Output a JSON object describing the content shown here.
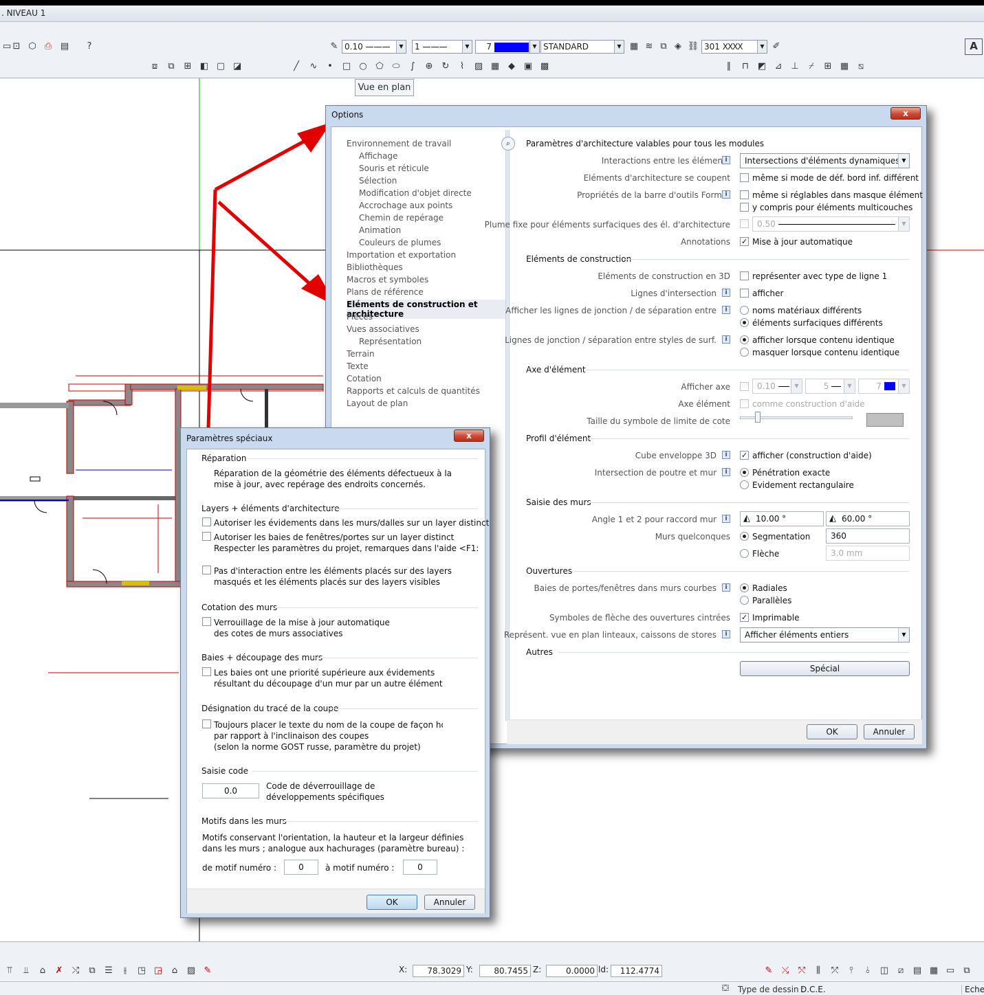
{
  "app": {
    "window_title": ". NIVEAU 1"
  },
  "toolbar": {
    "pen_value": "0.10",
    "line_value": "1",
    "color_value": "7",
    "layer_value": "STANDARD",
    "hatch_value": "301",
    "tooltip": "Vue en plan",
    "color_accent": "#0000ff"
  },
  "options": {
    "title": "Options",
    "close_label": "x",
    "nav": [
      "Environnement de travail",
      "Affichage",
      "Souris et réticule",
      "Sélection",
      "Modification d'objet directe",
      "Accrochage aux points",
      "Chemin de repérage",
      "Animation",
      "Couleurs de plumes",
      "Importation et exportation",
      "Bibliothèques",
      "Macros et symboles",
      "Plans de référence",
      "Eléments de construction et architecture",
      "Pièces",
      "Vues associatives",
      "Représentation",
      "Terrain",
      "Texte",
      "Cotation",
      "Rapports et calculs de quantités",
      "Layout de plan"
    ],
    "main_header": "Paramètres d'architecture valables pour tous les modules",
    "labels": {
      "interactions": "Interactions entre les éléments",
      "se_coupent": "Eléments d'architecture se coupent",
      "proprietes": "Propriétés de la barre d'outils Format",
      "plume_fixe": "Plume fixe pour éléments surfaciques des él. d'architecture",
      "annotations": "Annotations",
      "elements_3d": "Eléments de construction en 3D",
      "lignes_inter": "Lignes d'intersection",
      "afficher_lignes": "Afficher les lignes de jonction / de séparation entre",
      "lignes_styles": "Lignes de jonction / séparation entre styles de surf.",
      "afficher_axe": "Afficher axe",
      "axe_element": "Axe élément",
      "taille_symbole": "Taille du symbole de limite de cote",
      "cube": "Cube enveloppe 3D",
      "intersection_poutre": "Intersection de poutre et mur",
      "angle": "Angle 1 et 2 pour raccord mur",
      "murs_quelconques": "Murs quelconques",
      "baies_courbes": "Baies de portes/fenêtres dans murs courbes",
      "symboles_fleche": "Symboles de flèche des ouvertures cintrées",
      "represent": "Représent. vue en plan linteaux, caissons de stores"
    },
    "sections": {
      "construction": "Eléments de construction",
      "axe": "Axe d'élément",
      "profil": "Profil d'élément",
      "saisie": "Saisie des murs",
      "ouvertures": "Ouvertures",
      "autres": "Autres"
    },
    "values": {
      "interactions_combo": "Intersections d'éléments dynamiques",
      "chk_bord": "même si mode de déf. bord inf. différent",
      "chk_masque": "même si réglables dans masque élément",
      "chk_multicouches": "y compris pour éléments multicouches",
      "plume_val": "0.50",
      "chk_maj": "Mise à jour automatique",
      "chk_type_ligne": "représenter avec type de ligne 1",
      "chk_afficher": "afficher",
      "rad_noms": "noms matériaux différents",
      "rad_surf": "éléments surfaciques différents",
      "rad_afficher_id": "afficher lorsque contenu identique",
      "rad_masquer_id": "masquer lorsque contenu identique",
      "axe_pen": "0.10",
      "axe_line": "5",
      "axe_color": "7",
      "chk_aide": "comme construction d'aide",
      "chk_cube": "afficher (construction d'aide)",
      "rad_penetration": "Pénétration exacte",
      "rad_evidement": "Evidement rectangulaire",
      "angle1": "10.00 °",
      "angle2": "60.00 °",
      "rad_segmentation": "Segmentation",
      "segmentation_val": "360",
      "rad_fleche": "Flèche",
      "fleche_val": "3.0 mm",
      "rad_radiales": "Radiales",
      "rad_paralleles": "Parallèles",
      "chk_imprimable": "Imprimable",
      "represent_combo": "Afficher éléments entiers",
      "special_btn": "Spécial",
      "color_swatch": "#c0c0c0"
    },
    "ok": "OK",
    "cancel": "Annuler"
  },
  "special": {
    "title": "Paramètres spéciaux",
    "close_label": "x",
    "groups": {
      "reparation": "Réparation",
      "layers": "Layers + éléments d'architecture",
      "cotation": "Cotation des murs",
      "baies": "Baies + découpage des murs",
      "designation": "Désignation du tracé de la coupe",
      "saisie_code": "Saisie code",
      "motifs": "Motifs dans les murs"
    },
    "texts": {
      "rep_1": "Réparation de la géométrie des éléments défectueux à la",
      "rep_2": "mise à jour, avec repérage des endroits concernés.",
      "lay_1": "Autoriser les évidements dans les murs/dalles sur un layer distinct",
      "lay_2": "Autoriser les baies de fenêtres/portes sur un layer distinct",
      "lay_2b": "Respecter les paramètres du projet, remarques dans l'aide <F1:",
      "lay_3": "Pas d'interaction entre les éléments placés sur des layers",
      "lay_3b": "masqués et les éléments placés sur des layers visibles",
      "cot_1": "Verrouillage de la mise à jour automatique",
      "cot_1b": "des cotes de murs associatives",
      "baie_1": "Les baies ont une priorité supérieure aux évidements",
      "baie_1b": "résultant du découpage d'un mur par un autre élément",
      "des_1": "Toujours placer le texte du nom de la coupe de façon horizonta",
      "des_1b": "par rapport à l'inclinaison des coupes",
      "des_1c": "(selon la norme GOST russe, paramètre du projet)",
      "code_val": "0.0",
      "code_1": "Code de déverrouillage de",
      "code_2": "développements spécifiques",
      "mot_1": "Motifs conservant l'orientation, la hauteur et la largeur définies",
      "mot_2": "dans les murs ; analogue aux hachurages (paramètre bureau) :",
      "de_motif": "de motif numéro :",
      "de_motif_val": "0",
      "a_motif": "à motif numéro :",
      "a_motif_val": "0"
    },
    "ok": "OK",
    "cancel": "Annuler"
  },
  "status": {
    "x_label": "X:",
    "x_val": "78.3029",
    "y_label": "Y:",
    "y_val": "80.7455",
    "z_label": "Z:",
    "z_val": "0.0000",
    "id_label": "ld:",
    "id_val": "112.4774",
    "type_label": "Type de dessin :",
    "type_val": "D.C.E.",
    "echelle": "Echel"
  }
}
